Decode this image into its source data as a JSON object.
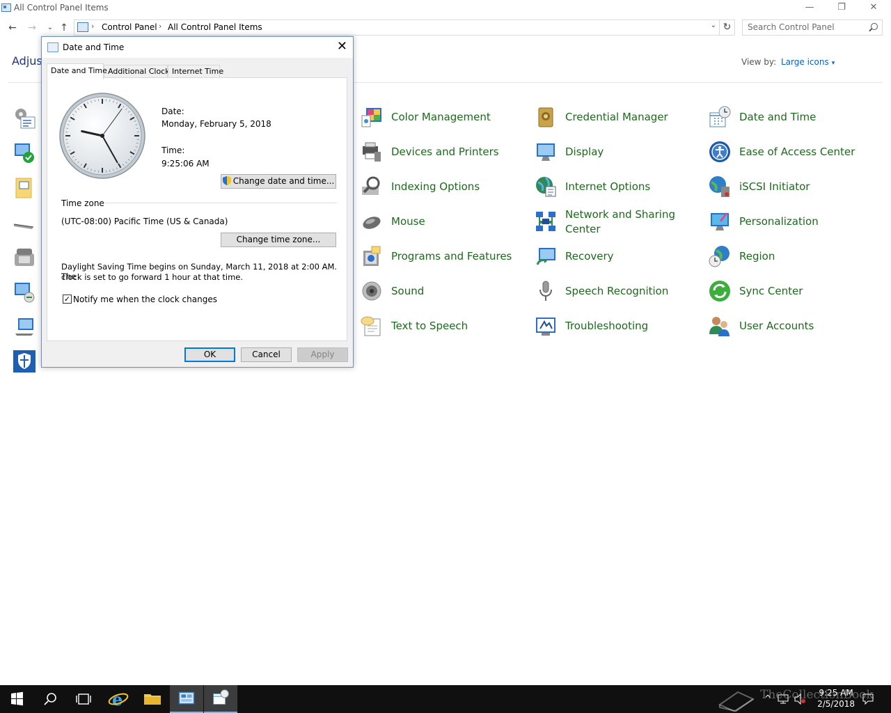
{
  "window": {
    "title": "All Control Panel Items",
    "minimize": "—",
    "maximize": "❐",
    "close": "✕"
  },
  "address": {
    "crumbs": [
      "Control Panel",
      "All Control Panel Items"
    ],
    "separator": "›",
    "search_placeholder": "Search Control Panel"
  },
  "nav": {
    "back": "←",
    "forward": "→",
    "recent": "⌄",
    "up": "↑",
    "dropdown": "⌄",
    "refresh": "↻"
  },
  "content": {
    "heading": "Adjust",
    "view_by_label": "View by:",
    "view_by_value": "Large icons",
    "view_by_caret": "▾"
  },
  "items": [
    {
      "label": "Color Management",
      "icon": "color-management-icon"
    },
    {
      "label": "Credential Manager",
      "icon": "credential-manager-icon"
    },
    {
      "label": "Date and Time",
      "icon": "date-time-icon"
    },
    {
      "label": "Devices and Printers",
      "icon": "devices-printers-icon"
    },
    {
      "label": "Display",
      "icon": "display-icon"
    },
    {
      "label": "Ease of Access Center",
      "icon": "ease-of-access-icon"
    },
    {
      "label": "Indexing Options",
      "icon": "indexing-options-icon"
    },
    {
      "label": "Internet Options",
      "icon": "internet-options-icon"
    },
    {
      "label": "iSCSI Initiator",
      "icon": "iscsi-initiator-icon"
    },
    {
      "label": "Mouse",
      "icon": "mouse-icon"
    },
    {
      "label": "Network and Sharing Center",
      "icon": "network-sharing-icon"
    },
    {
      "label": "Personalization",
      "icon": "personalization-icon"
    },
    {
      "label": "Programs and Features",
      "icon": "programs-features-icon"
    },
    {
      "label": "Recovery",
      "icon": "recovery-icon"
    },
    {
      "label": "Region",
      "icon": "region-icon"
    },
    {
      "label": "Sound",
      "icon": "sound-icon"
    },
    {
      "label": "Speech Recognition",
      "icon": "speech-recognition-icon"
    },
    {
      "label": "Sync Center",
      "icon": "sync-center-icon"
    },
    {
      "label": "Text to Speech",
      "icon": "text-to-speech-icon"
    },
    {
      "label": "Troubleshooting",
      "icon": "troubleshooting-icon"
    },
    {
      "label": "User Accounts",
      "icon": "user-accounts-icon"
    }
  ],
  "dialog": {
    "title": "Date and Time",
    "close": "✕",
    "tabs": [
      "Date and Time",
      "Additional Clocks",
      "Internet Time"
    ],
    "date_label": "Date:",
    "date_value": "Monday, February 5, 2018",
    "time_label": "Time:",
    "time_value": "9:25:06 AM",
    "change_datetime_button": "Change date and time...",
    "timezone_label": "Time zone",
    "timezone_value": "(UTC-08:00) Pacific Time (US & Canada)",
    "change_timezone_button": "Change time zone...",
    "dst_line1": "Daylight Saving Time begins on Sunday, March 11, 2018 at 2:00 AM. The",
    "dst_line2": "clock is set to go forward 1 hour at that time.",
    "notify_checked": true,
    "notify_check_glyph": "✓",
    "notify_label": "Notify me when the clock changes",
    "ok": "OK",
    "cancel": "Cancel",
    "apply": "Apply"
  },
  "clock": {
    "hour": 9,
    "minute": 25,
    "second": 6
  },
  "taskbar": {
    "time": "9:25 AM",
    "date": "2/5/2018",
    "watermark": "TheCollectionBook"
  },
  "colors": {
    "link_green": "#1a6b1a",
    "link_blue": "#0066cc",
    "heading_blue": "#1e3287",
    "taskbar": "#101010",
    "accent": "#0078d7"
  }
}
